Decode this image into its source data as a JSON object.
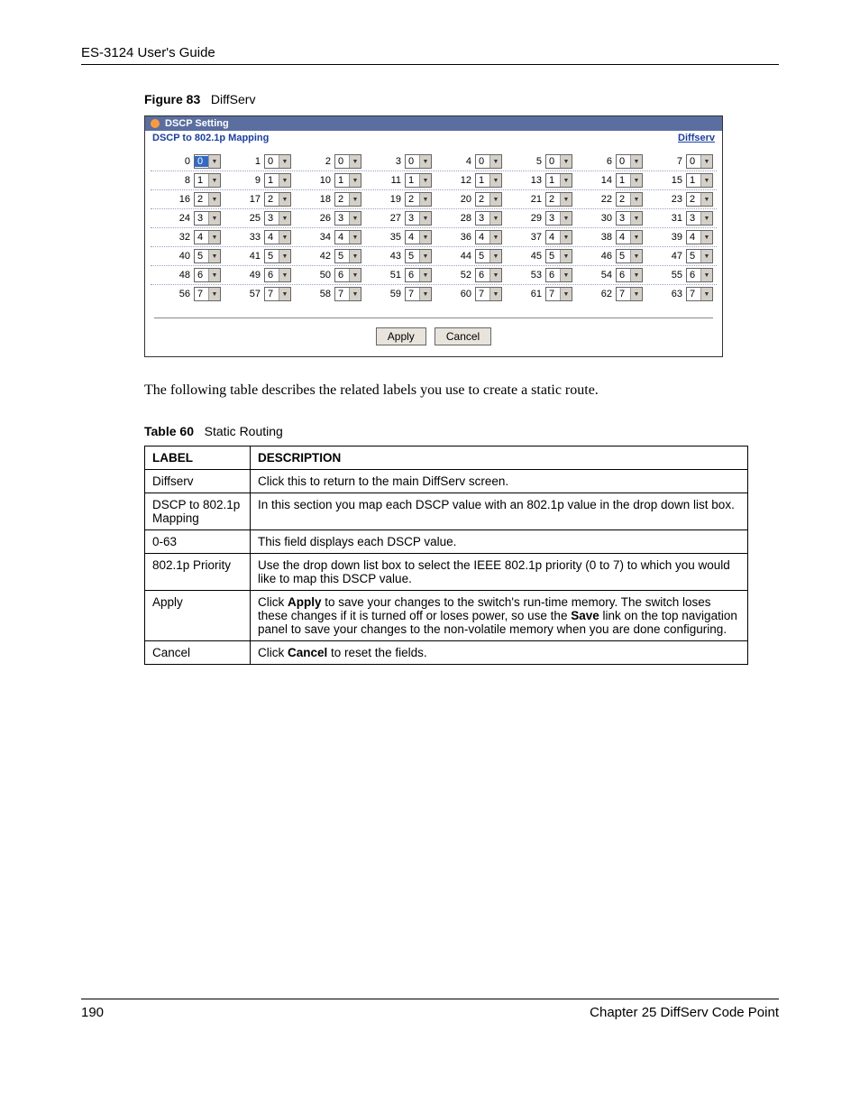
{
  "header": {
    "guide_title": "ES-3124 User's Guide"
  },
  "figure": {
    "label": "Figure 83",
    "title": "DiffServ"
  },
  "screenshot": {
    "titlebar": "DSCP Setting",
    "subhead": "DSCP to 802.1p Mapping",
    "link": "Diffserv",
    "rows": [
      [
        {
          "n": "0",
          "v": "0",
          "hl": true
        },
        {
          "n": "1",
          "v": "0"
        },
        {
          "n": "2",
          "v": "0"
        },
        {
          "n": "3",
          "v": "0"
        },
        {
          "n": "4",
          "v": "0"
        },
        {
          "n": "5",
          "v": "0"
        },
        {
          "n": "6",
          "v": "0"
        },
        {
          "n": "7",
          "v": "0"
        }
      ],
      [
        {
          "n": "8",
          "v": "1"
        },
        {
          "n": "9",
          "v": "1"
        },
        {
          "n": "10",
          "v": "1"
        },
        {
          "n": "11",
          "v": "1"
        },
        {
          "n": "12",
          "v": "1"
        },
        {
          "n": "13",
          "v": "1"
        },
        {
          "n": "14",
          "v": "1"
        },
        {
          "n": "15",
          "v": "1"
        }
      ],
      [
        {
          "n": "16",
          "v": "2"
        },
        {
          "n": "17",
          "v": "2"
        },
        {
          "n": "18",
          "v": "2"
        },
        {
          "n": "19",
          "v": "2"
        },
        {
          "n": "20",
          "v": "2"
        },
        {
          "n": "21",
          "v": "2"
        },
        {
          "n": "22",
          "v": "2"
        },
        {
          "n": "23",
          "v": "2"
        }
      ],
      [
        {
          "n": "24",
          "v": "3"
        },
        {
          "n": "25",
          "v": "3"
        },
        {
          "n": "26",
          "v": "3"
        },
        {
          "n": "27",
          "v": "3"
        },
        {
          "n": "28",
          "v": "3"
        },
        {
          "n": "29",
          "v": "3"
        },
        {
          "n": "30",
          "v": "3"
        },
        {
          "n": "31",
          "v": "3"
        }
      ],
      [
        {
          "n": "32",
          "v": "4"
        },
        {
          "n": "33",
          "v": "4"
        },
        {
          "n": "34",
          "v": "4"
        },
        {
          "n": "35",
          "v": "4"
        },
        {
          "n": "36",
          "v": "4"
        },
        {
          "n": "37",
          "v": "4"
        },
        {
          "n": "38",
          "v": "4"
        },
        {
          "n": "39",
          "v": "4"
        }
      ],
      [
        {
          "n": "40",
          "v": "5"
        },
        {
          "n": "41",
          "v": "5"
        },
        {
          "n": "42",
          "v": "5"
        },
        {
          "n": "43",
          "v": "5"
        },
        {
          "n": "44",
          "v": "5"
        },
        {
          "n": "45",
          "v": "5"
        },
        {
          "n": "46",
          "v": "5"
        },
        {
          "n": "47",
          "v": "5"
        }
      ],
      [
        {
          "n": "48",
          "v": "6"
        },
        {
          "n": "49",
          "v": "6"
        },
        {
          "n": "50",
          "v": "6"
        },
        {
          "n": "51",
          "v": "6"
        },
        {
          "n": "52",
          "v": "6"
        },
        {
          "n": "53",
          "v": "6"
        },
        {
          "n": "54",
          "v": "6"
        },
        {
          "n": "55",
          "v": "6"
        }
      ],
      [
        {
          "n": "56",
          "v": "7"
        },
        {
          "n": "57",
          "v": "7"
        },
        {
          "n": "58",
          "v": "7"
        },
        {
          "n": "59",
          "v": "7"
        },
        {
          "n": "60",
          "v": "7"
        },
        {
          "n": "61",
          "v": "7"
        },
        {
          "n": "62",
          "v": "7"
        },
        {
          "n": "63",
          "v": "7"
        }
      ]
    ],
    "buttons": {
      "apply": "Apply",
      "cancel": "Cancel"
    }
  },
  "paragraph": "The following table describes the related labels you use to create a static route.",
  "table": {
    "label": "Table 60",
    "title": "Static Routing",
    "head": {
      "c1": "LABEL",
      "c2": "DESCRIPTION"
    },
    "rows": [
      {
        "label": "Diffserv",
        "desc": "Click this to return to the main DiffServ screen."
      },
      {
        "label": "DSCP to 802.1p Mapping",
        "desc": "In this section you map each DSCP value with an 802.1p value in the drop down list box."
      },
      {
        "label": "0-63",
        "desc": "This field displays each DSCP value."
      },
      {
        "label": "802.1p Priority",
        "desc": "Use the drop down list box to select the IEEE 802.1p priority (0 to 7) to which you would like to map this DSCP value."
      },
      {
        "label": "Apply",
        "desc_html": "Click <b class='inline'>Apply</b> to save your changes to the switch's run-time memory. The switch loses these changes if it is turned off or loses power, so use the <b class='inline'>Save</b> link on the top navigation panel to save your changes to the non-volatile memory when you are done configuring."
      },
      {
        "label": "Cancel",
        "desc_html": "Click <b class='inline'>Cancel</b> to reset the fields."
      }
    ]
  },
  "footer": {
    "page": "190",
    "chapter": "Chapter 25 DiffServ Code Point"
  }
}
